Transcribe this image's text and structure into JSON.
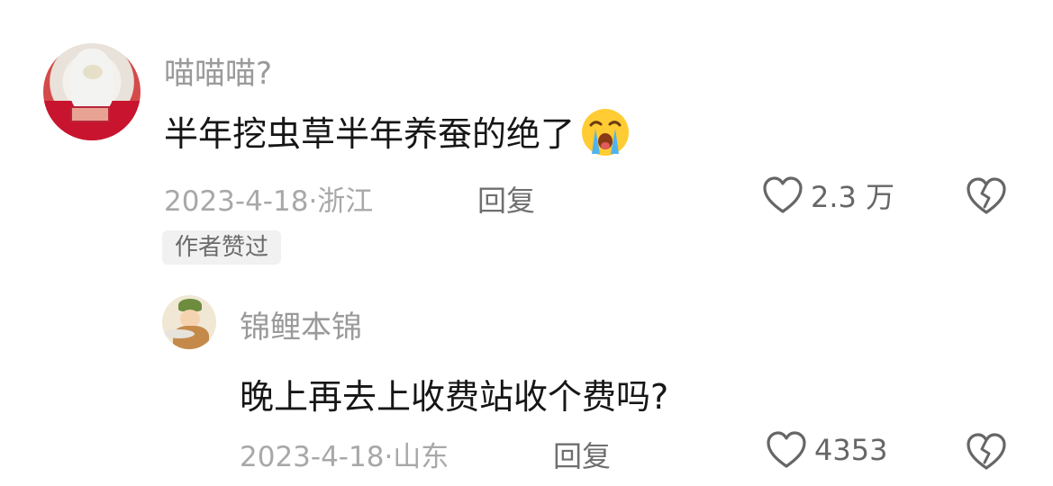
{
  "comment": {
    "username": "喵喵喵?",
    "text": "半年挖虫草半年养蚕的绝了",
    "emoji": "loudly-crying-face",
    "date": "2023-4-18",
    "location": "浙江",
    "reply_label": "回复",
    "like_count": "2.3 万",
    "author_badge": "作者赞过"
  },
  "reply": {
    "username": "锦鲤本锦",
    "text": "晚上再去上收费站收个费吗?",
    "date": "2023-4-18",
    "location": "山东",
    "reply_label": "回复",
    "like_count": "4353"
  }
}
